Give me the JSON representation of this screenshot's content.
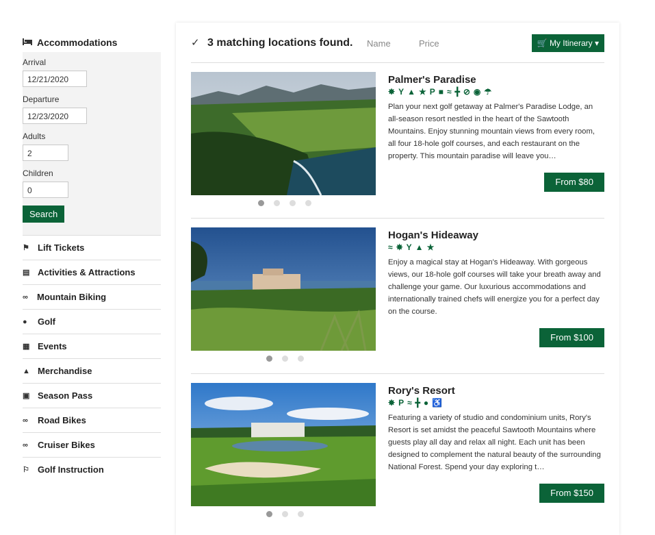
{
  "sidebar": {
    "heading": "Accommodations",
    "form": {
      "arrival_label": "Arrival",
      "arrival_value": "12/21/2020",
      "departure_label": "Departure",
      "departure_value": "12/23/2020",
      "adults_label": "Adults",
      "adults_value": "2",
      "children_label": "Children",
      "children_value": "0",
      "search_label": "Search"
    },
    "nav": [
      {
        "label": "Lift Tickets",
        "icon": "tag-icon"
      },
      {
        "label": "Activities & Attractions",
        "icon": "ticket-icon"
      },
      {
        "label": "Mountain Biking",
        "icon": "bicycle-icon"
      },
      {
        "label": "Golf",
        "icon": "golf-ball-icon"
      },
      {
        "label": "Events",
        "icon": "calendar-icon"
      },
      {
        "label": "Merchandise",
        "icon": "shopping-bag-icon"
      },
      {
        "label": "Season Pass",
        "icon": "pass-card-icon"
      },
      {
        "label": "Road Bikes",
        "icon": "bicycle-icon"
      },
      {
        "label": "Cruiser Bikes",
        "icon": "bicycle-icon"
      },
      {
        "label": "Golf Instruction",
        "icon": "flag-icon"
      }
    ]
  },
  "results_bar": {
    "found_text": "3 matching locations found.",
    "sort_name": "Name",
    "sort_price": "Price",
    "itinerary_label": "My Itinerary"
  },
  "results": [
    {
      "name": "Palmer's Paradise",
      "description": "Plan your next golf getaway at Palmer's Paradise Lodge, an all-season resort nestled in the heart of the Sawtooth Mountains. Enjoy stunning mountain views from every room, all four 18-hole golf courses, and each restaurant on the property. This mountain paradise will leave you…",
      "price": "From $80",
      "amenities": [
        "spa",
        "cocktail",
        "room-service",
        "group",
        "parking",
        "shirt",
        "wifi",
        "fitness",
        "no-smoking",
        "cooking",
        "beach"
      ],
      "photos": 4
    },
    {
      "name": "Hogan's Hideaway",
      "description": "Enjoy a magical stay at Hogan's Hideaway. With gorgeous views, our 18-hole golf courses will take your breath away and challenge your game. Our luxurious accommodations and internationally trained chefs will energize you for a perfect day on the course.",
      "price": "From $100",
      "amenities": [
        "wifi",
        "spa",
        "cocktail",
        "room-service",
        "group"
      ],
      "photos": 3
    },
    {
      "name": "Rory's Resort",
      "description": "Featuring a variety of studio and condominium units, Rory's Resort is set amidst the peaceful Sawtooth Mountains where guests play all day and relax all night. Each unit has been designed to complement the natural beauty of the surrounding National Forest. Spend your day exploring t…",
      "price": "From $150",
      "amenities": [
        "spa",
        "parking",
        "wifi",
        "fitness",
        "golf",
        "accessible"
      ],
      "photos": 3
    }
  ]
}
